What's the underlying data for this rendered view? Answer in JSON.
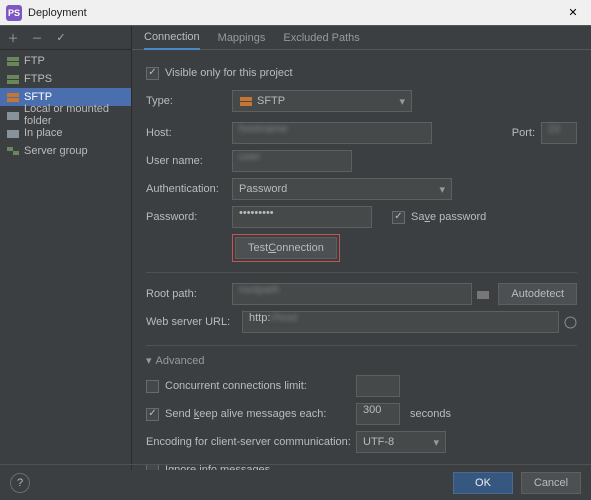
{
  "window": {
    "title": "Deployment"
  },
  "sidebar": {
    "items": [
      {
        "label": "FTP"
      },
      {
        "label": "FTPS"
      },
      {
        "label": "SFTP"
      },
      {
        "label": "Local or mounted folder"
      },
      {
        "label": "In place"
      },
      {
        "label": "Server group"
      }
    ]
  },
  "tabs": {
    "connection": "Connection",
    "mappings": "Mappings",
    "excluded": "Excluded Paths"
  },
  "form": {
    "visible_only": "Visible only for this project",
    "type_label": "Type:",
    "type_value": "SFTP",
    "host_label": "Host:",
    "port_label": "Port:",
    "user_label": "User name:",
    "auth_label": "Authentication:",
    "auth_value": "Password",
    "password_label": "Password:",
    "password_value": "•••••••••",
    "save_password": "Save password",
    "test_connection": "Test Connection",
    "root_label": "Root path:",
    "autodetect": "Autodetect",
    "web_label": "Web server URL:",
    "web_value": "http:",
    "advanced": "Advanced",
    "concurrent": "Concurrent connections limit:",
    "keepalive": "Send keep alive messages each:",
    "keepalive_value": "300",
    "seconds": "seconds",
    "encoding_label": "Encoding for client-server communication:",
    "encoding_value": "UTF-8",
    "ignore_info": "Ignore info messages"
  },
  "footer": {
    "ok": "OK",
    "cancel": "Cancel",
    "help": "?"
  }
}
